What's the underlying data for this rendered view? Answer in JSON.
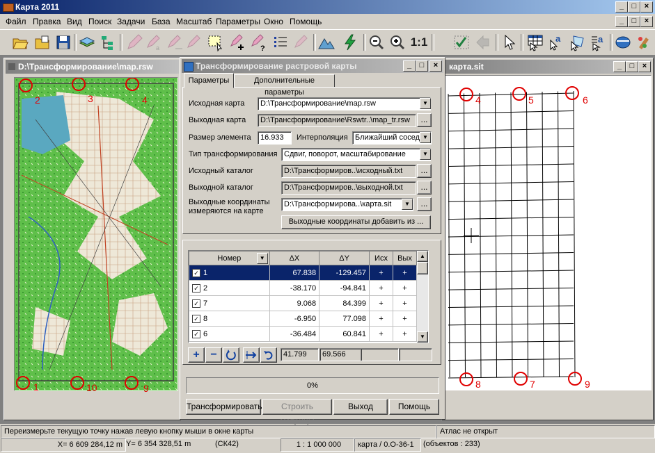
{
  "app": {
    "title": "Карта 2011"
  },
  "menu": [
    "Файл",
    "Правка",
    "Вид",
    "Поиск",
    "Задачи",
    "База",
    "Масштаб",
    "Параметры",
    "Окно",
    "Помощь"
  ],
  "toolbar": {
    "scale_label": "1:1"
  },
  "left_window": {
    "title": "D:\\Трансформирование\\map.rsw"
  },
  "right_window": {
    "title": "карта.sit"
  },
  "left_markers": [
    "1",
    "2",
    "3",
    "4",
    "9",
    "10"
  ],
  "right_markers": [
    "4",
    "5",
    "6",
    "7",
    "8",
    "9"
  ],
  "dialog": {
    "title": "Трансформирование растровой карты",
    "tabs": [
      "Параметры",
      "Дополнительные параметры"
    ],
    "source_map_label": "Исходная карта",
    "source_map_value": "D:\\Трансформирование\\map.rsw",
    "output_map_label": "Выходная карта",
    "output_map_value": "D:\\Трансформирование\\Rswtr..\\map_tr.rsw",
    "element_size_label": "Размер элемента",
    "element_size_value": "16.933",
    "interpolation_label": "Интерполяция",
    "interpolation_value": "Ближайший сосед",
    "transform_type_label": "Тип трансформирования",
    "transform_type_value": "Сдвиг, поворот, масштабирование",
    "source_catalog_label": "Исходный каталог",
    "source_catalog_value": "D:\\Трансформиров..\\исходный.txt",
    "output_catalog_label": "Выходной каталог",
    "output_catalog_value": "D:\\Трансформиров..\\выходной.txt",
    "output_coords_label_1": "Выходные координаты",
    "output_coords_label_2": "измеряются на карте",
    "output_coords_value": "D:\\Трансформирова..\\карта.sit",
    "add_coords_button": "Выходные координаты добавить из ...",
    "browse": "...",
    "table": {
      "headers": [
        "Номер",
        "ΔX",
        "ΔY",
        "Исх",
        "Вых"
      ],
      "rows": [
        {
          "num": "1",
          "dx": "67.838",
          "dy": "-129.457",
          "src": "+",
          "dst": "+"
        },
        {
          "num": "2",
          "dx": "-38.170",
          "dy": "-94.841",
          "src": "+",
          "dst": "+"
        },
        {
          "num": "7",
          "dx": "9.068",
          "dy": "84.399",
          "src": "+",
          "dst": "+"
        },
        {
          "num": "8",
          "dx": "-6.950",
          "dy": "77.098",
          "src": "+",
          "dst": "+"
        },
        {
          "num": "6",
          "dx": "-36.484",
          "dy": "60.841",
          "src": "+",
          "dst": "+"
        }
      ]
    },
    "totals": {
      "dx": "41.799",
      "dy": "69.566"
    },
    "progress": {
      "label": "0%",
      "fraction": 0
    },
    "buttons": {
      "transform": "Трансформировать",
      "build": "Строить матрицы",
      "exit": "Выход",
      "help": "Помощь"
    },
    "tool_buttons": {
      "add": "+",
      "remove": "−"
    }
  },
  "status": {
    "hint": "Переизмерьте текущую точку нажав левую кнопку мыши в окне карты",
    "atlas": "Атлас не открыт",
    "x": "X= 6 609 284,12 m",
    "y": "Y= 6 354 328,51 m",
    "cs": "(СК42)",
    "scale": "1 : 1 000 000",
    "map": "карта / 0.O-36-1",
    "objects": "(объектов : 233)"
  },
  "colors": {
    "titlebar": "#0a246a",
    "selection": "#0a246a",
    "marker": "#e00000",
    "forest": "#5fbf4a"
  }
}
